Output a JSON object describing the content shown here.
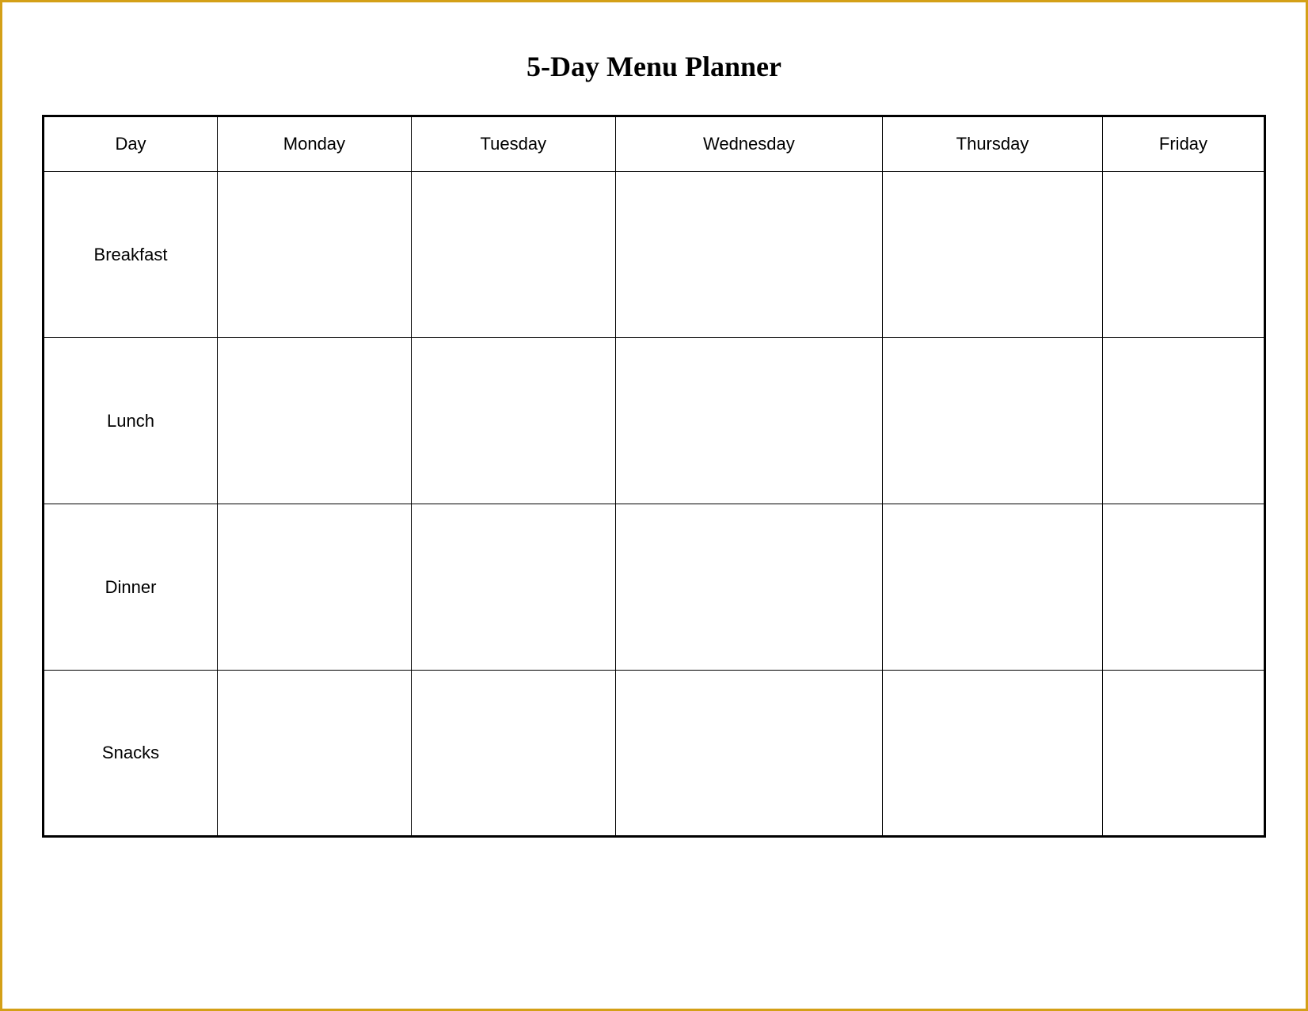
{
  "title": "5-Day Menu Planner",
  "table": {
    "headers": [
      "Day",
      "Monday",
      "Tuesday",
      "Wednesday",
      "Thursday",
      "Friday"
    ],
    "rows": [
      {
        "label": "Breakfast",
        "cells": [
          "",
          "",
          "",
          "",
          ""
        ]
      },
      {
        "label": "Lunch",
        "cells": [
          "",
          "",
          "",
          "",
          ""
        ]
      },
      {
        "label": "Dinner",
        "cells": [
          "",
          "",
          "",
          "",
          ""
        ]
      },
      {
        "label": "Snacks",
        "cells": [
          "",
          "",
          "",
          "",
          ""
        ]
      }
    ]
  }
}
